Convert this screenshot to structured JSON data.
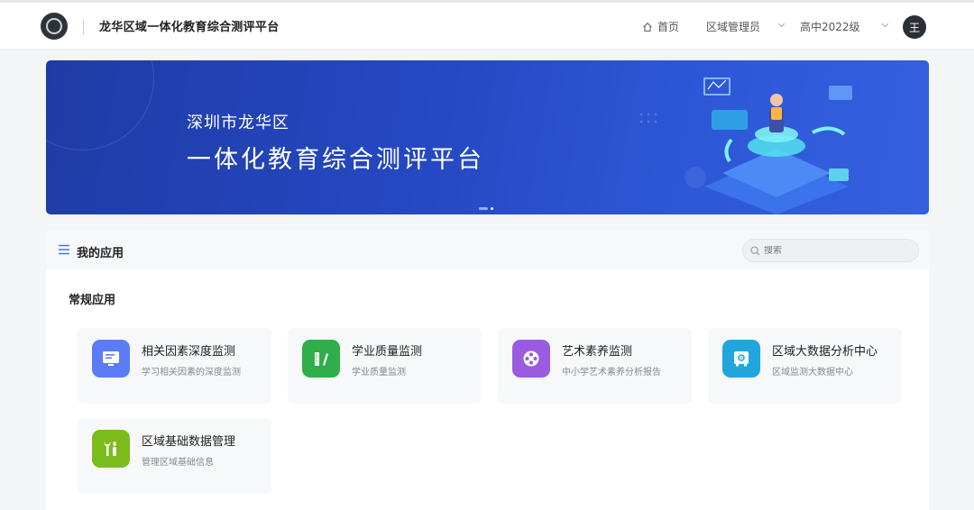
{
  "header": {
    "title": "龙华区域一体化教育综合测评平台",
    "home_label": "首页",
    "role_label": "区域管理员",
    "grade_label": "高中2022级",
    "avatar_text": "王"
  },
  "banner": {
    "subtitle": "深圳市龙华区",
    "title": "一体化教育综合测评平台"
  },
  "apps_panel": {
    "title": "我的应用",
    "search_placeholder": "搜索",
    "section_title": "常规应用",
    "apps": [
      {
        "name": "相关因素深度监测",
        "desc": "学习相关因素的深度监测",
        "color": "#5b7cf6",
        "icon": "monitor-icon"
      },
      {
        "name": "学业质量监测",
        "desc": "学业质量监测",
        "color": "#2fae4a",
        "icon": "ruler-pen-icon"
      },
      {
        "name": "艺术素养监测",
        "desc": "中小学艺术素养分析报告",
        "color": "#9b5be0",
        "icon": "film-reel-icon"
      },
      {
        "name": "区域大数据分析中心",
        "desc": "区域监测大数据中心",
        "color": "#22a5dd",
        "icon": "safe-box-icon"
      },
      {
        "name": "区域基础数据管理",
        "desc": "管理区域基础信息",
        "color": "#7cbb1c",
        "icon": "tools-icon"
      }
    ]
  },
  "colors": {
    "banner_blue": "#2549c4",
    "avatar_bg": "#2b3036"
  }
}
